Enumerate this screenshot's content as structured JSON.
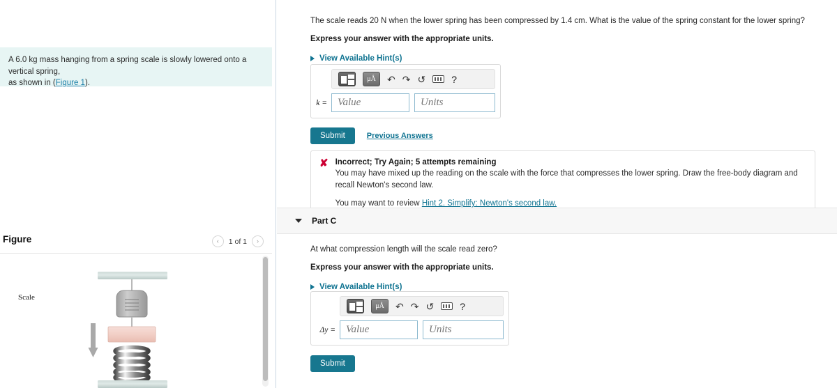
{
  "left": {
    "problem_statement_prefix": "A 6.0 kg mass hanging from a spring scale is slowly lowered onto a vertical spring, as shown in (",
    "problem_statement_mass": "6.0 kg",
    "problem_statement_line1": "A 6.0 kg mass hanging from a spring scale is slowly lowered onto a vertical spring,",
    "problem_statement_line2": "as shown in (",
    "figure_link": "Figure 1",
    "problem_statement_end": ").",
    "figure_title": "Figure",
    "pager_prev": "‹",
    "pager_label": "1 of 1",
    "pager_next": "›",
    "figure_scale_label": "Scale"
  },
  "part_b": {
    "question": "The scale reads 20 N when the lower spring has been compressed by 1.4 cm. What is the value of the spring constant for the lower spring?",
    "question_pre": "The scale reads 20",
    "question_unit1": "N",
    "question_mid": "when the lower spring has been compressed by 1.4",
    "question_unit2": "cm.",
    "question_post": "What is the value of the spring constant for the lower spring?",
    "instruction": "Express your answer with the appropriate units.",
    "hint_link": "View Available Hint(s)",
    "answer": {
      "variable": "k =",
      "value_placeholder": "Value",
      "units_placeholder": "Units",
      "value": "",
      "units": "",
      "toolbar": {
        "template_icon": "template-icon",
        "units_icon": "μÅ",
        "undo_icon": "↶",
        "redo_icon": "↷",
        "reset_icon": "↺",
        "keyboard_icon": "keyboard-icon",
        "help_icon": "?"
      }
    },
    "submit_label": "Submit",
    "previous_answers_label": "Previous Answers",
    "feedback": {
      "mark": "✘",
      "title": "Incorrect; Try Again; 5 attempts remaining",
      "body": "You may have mixed up the reading on the scale with the force that compresses the lower spring. Draw the free-body diagram and recall Newton's second law.",
      "review_prefix": "You may want to review ",
      "review_link": "Hint 2. Simplify: Newton's second law."
    }
  },
  "part_c": {
    "header_label": "Part C",
    "question": "At what compression length will the scale read zero?",
    "instruction": "Express your answer with the appropriate units.",
    "hint_link": "View Available Hint(s)",
    "answer": {
      "variable": "Δy =",
      "value_placeholder": "Value",
      "units_placeholder": "Units",
      "value": "",
      "units": "",
      "toolbar": {
        "template_icon": "template-icon",
        "units_icon": "μÅ",
        "undo_icon": "↶",
        "redo_icon": "↷",
        "reset_icon": "↺",
        "keyboard_icon": "keyboard-icon",
        "help_icon": "?"
      }
    },
    "submit_label": "Submit"
  },
  "colors": {
    "accent_teal": "#0f7391",
    "submit_bg": "#17778f",
    "problem_bg": "#e7f5f4",
    "error_red": "#cc0033",
    "input_border": "#8cb9cf",
    "part_header_bg": "#f7f7f7"
  }
}
